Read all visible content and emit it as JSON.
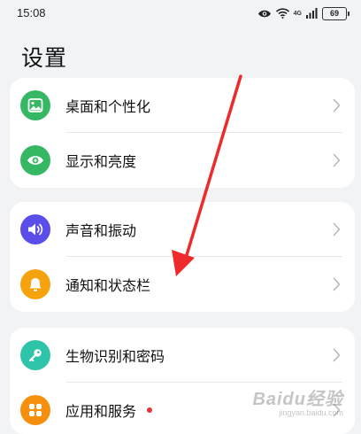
{
  "status_bar": {
    "time": "15:08",
    "network": "4G",
    "battery": "69",
    "icons": [
      "eye-icon",
      "wifi-icon",
      "signal-icon",
      "battery-icon"
    ]
  },
  "page": {
    "title": "设置"
  },
  "groups": [
    {
      "items": [
        {
          "label": "桌面和个性化",
          "icon": "wallpaper-icon",
          "color": "#35b764"
        },
        {
          "label": "显示和亮度",
          "icon": "eye-icon",
          "color": "#35b764"
        }
      ]
    },
    {
      "items": [
        {
          "label": "声音和振动",
          "icon": "speaker-icon",
          "color": "#5a4de8"
        },
        {
          "label": "通知和状态栏",
          "icon": "bell-icon",
          "color": "#f5a20f"
        }
      ]
    },
    {
      "items": [
        {
          "label": "生物识别和密码",
          "icon": "key-icon",
          "color": "#2ec4a9"
        },
        {
          "label": "应用和服务",
          "icon": "apps-grid-icon",
          "color": "#f5900f",
          "badge": "red-dot"
        }
      ]
    }
  ],
  "annotation": {
    "arrow_color": "#ef2a2a"
  },
  "watermark": {
    "brand": "Baidu经验",
    "url": "jingyan.baidu.com"
  }
}
